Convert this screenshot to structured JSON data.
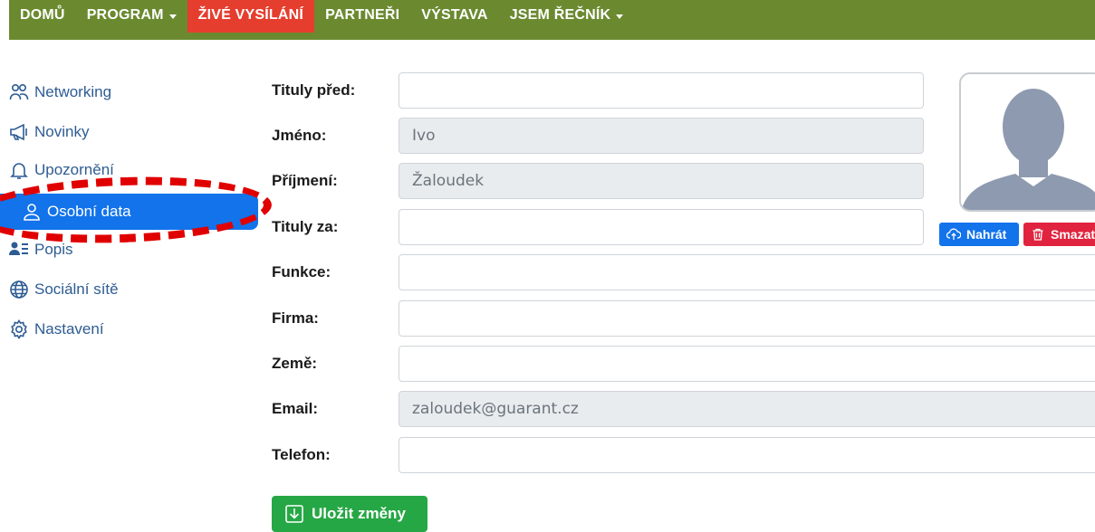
{
  "nav": {
    "items": [
      {
        "label": "DOMŮ",
        "caret": false
      },
      {
        "label": "PROGRAM",
        "caret": true
      },
      {
        "label": "ŽIVÉ VYSÍLÁNÍ",
        "caret": false
      },
      {
        "label": "PARTNEŘI",
        "caret": false
      },
      {
        "label": "VÝSTAVA",
        "caret": false
      },
      {
        "label": "JSEM ŘEČNÍK",
        "caret": true
      }
    ],
    "bar_color": "#6b8a30",
    "live_color": "#e53e2f"
  },
  "sidebar": {
    "items": [
      {
        "label": "Networking",
        "icon": "people-icon"
      },
      {
        "label": "Novinky",
        "icon": "megaphone-icon"
      },
      {
        "label": "Upozornění",
        "icon": "bell-icon"
      },
      {
        "label": "Osobní data",
        "icon": "person-icon",
        "active": true
      },
      {
        "label": "Popis",
        "icon": "person-lines-icon"
      },
      {
        "label": "Sociální sítě",
        "icon": "globe-icon"
      },
      {
        "label": "Nastavení",
        "icon": "gear-icon"
      }
    ],
    "active_color": "#1273eb",
    "highlight_color": "#e00000"
  },
  "form": {
    "fields": [
      {
        "label": "Tituly před:",
        "value": "",
        "readonly": false
      },
      {
        "label": "Jméno:",
        "value": "Ivo",
        "readonly": true
      },
      {
        "label": "Příjmení:",
        "value": "Žaloudek",
        "readonly": true
      },
      {
        "label": "Tituly za:",
        "value": "",
        "readonly": false
      },
      {
        "label": "Funkce:",
        "value": "",
        "readonly": false
      },
      {
        "label": "Firma:",
        "value": "",
        "readonly": false
      },
      {
        "label": "Země:",
        "value": "",
        "readonly": false
      },
      {
        "label": "Email:",
        "value": "zaloudek@guarant.cz",
        "readonly": true
      },
      {
        "label": "Telefon:",
        "value": "",
        "readonly": false
      }
    ],
    "save_label": "Uložit změny",
    "save_color": "#26a745"
  },
  "photo": {
    "upload_label": "Nahrát",
    "delete_label": "Smazat",
    "upload_color": "#1273eb",
    "delete_color": "#e0243f"
  }
}
